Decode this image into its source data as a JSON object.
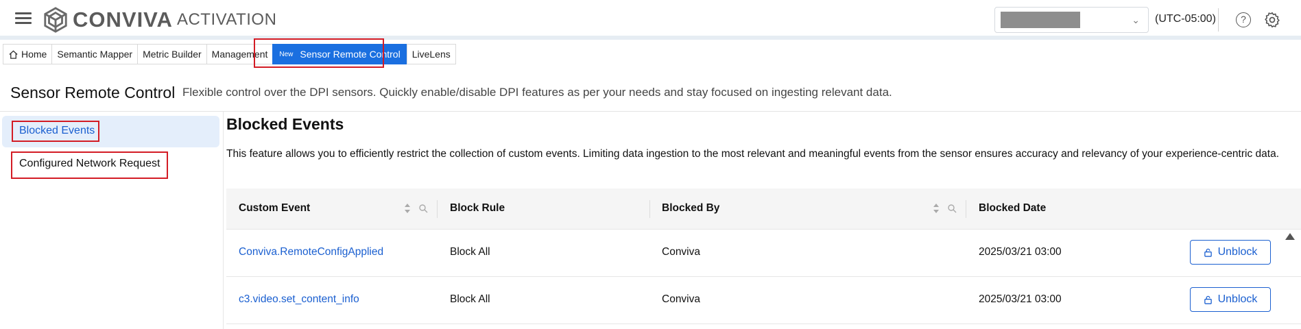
{
  "header": {
    "logo_word": "CONVIVA",
    "logo_sub": "ACTIVATION",
    "timezone": "(UTC-05:00)"
  },
  "tabs": [
    {
      "label": "Home",
      "icon": "home-icon"
    },
    {
      "label": "Semantic Mapper"
    },
    {
      "label": "Metric Builder"
    },
    {
      "label": "Management"
    },
    {
      "label": "Sensor Remote Control",
      "badge": "New",
      "active": true
    },
    {
      "label": "LiveLens"
    }
  ],
  "page": {
    "title": "Sensor Remote Control",
    "description": "Flexible control over the DPI sensors. Quickly enable/disable DPI features as per your needs and stay focused on ingesting relevant data."
  },
  "leftnav": {
    "items": [
      {
        "label": "Blocked Events",
        "selected": true
      },
      {
        "label": "Configured Network Request"
      }
    ]
  },
  "content": {
    "title": "Blocked Events",
    "description": "This feature allows you to efficiently restrict the collection of custom events. Limiting data ingestion to the most relevant and meaningful events from the sensor ensures accuracy and relevancy of your experience-centric data."
  },
  "table": {
    "columns": [
      "Custom Event",
      "Block Rule",
      "Blocked By",
      "Blocked Date"
    ],
    "rows": [
      {
        "event": "Conviva.RemoteConfigApplied",
        "rule": "Block All",
        "by": "Conviva",
        "date": "2025/03/21 03:00",
        "action": "Unblock"
      },
      {
        "event": "c3.video.set_content_info",
        "rule": "Block All",
        "by": "Conviva",
        "date": "2025/03/21 03:00",
        "action": "Unblock"
      }
    ]
  },
  "colors": {
    "accent": "#1a6fe0",
    "link": "#1a5fd0",
    "highlight": "#d31b24"
  }
}
